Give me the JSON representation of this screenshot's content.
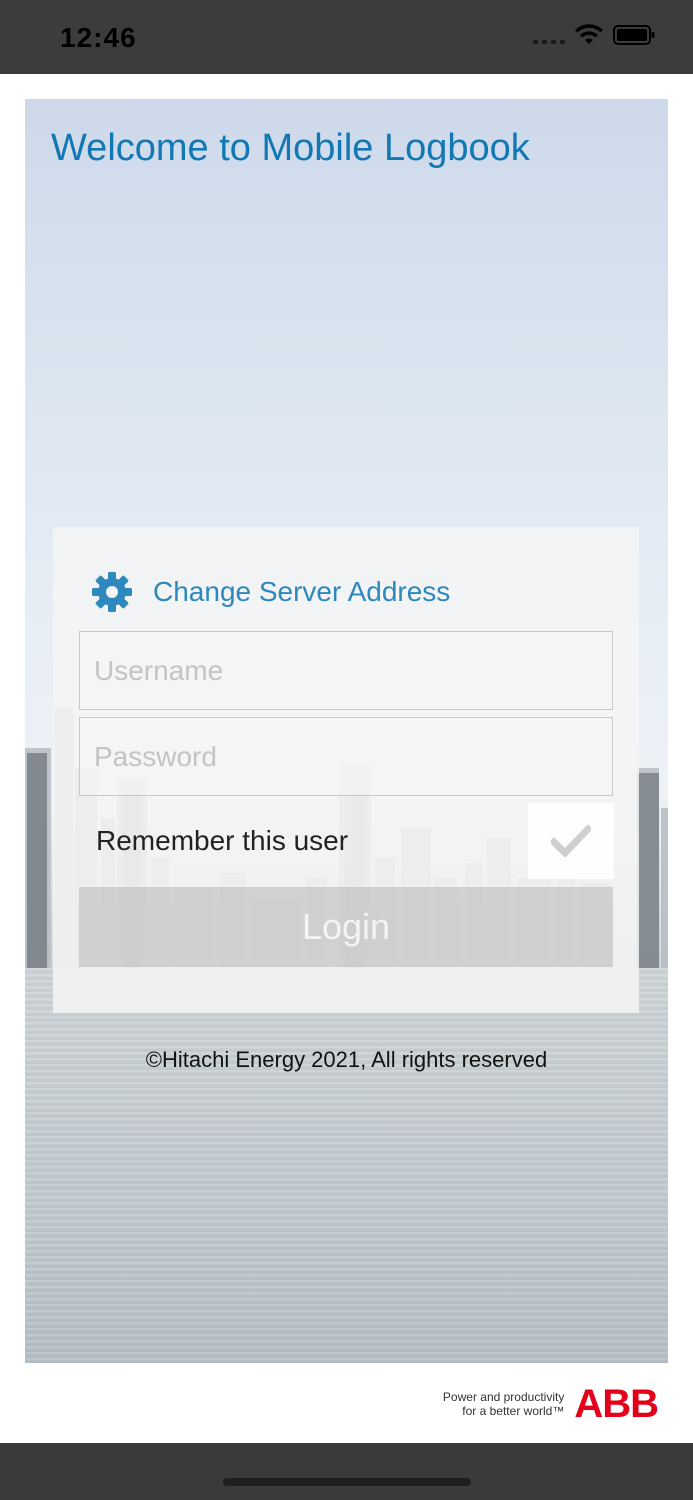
{
  "status_bar": {
    "time": "12:46"
  },
  "hero": {
    "welcome_title": "Welcome to Mobile Logbook"
  },
  "login": {
    "server_link_label": "Change Server Address",
    "username_placeholder": "Username",
    "password_placeholder": "Password",
    "remember_label": "Remember this user",
    "login_label": "Login"
  },
  "copyright": "©Hitachi Energy 2021, All rights reserved",
  "footer": {
    "tagline_line1": "Power and productivity",
    "tagline_line2": "for a better world™",
    "brand_logo_text": "ABB"
  },
  "colors": {
    "accent": "#1278b4",
    "link": "#2d88be",
    "brand_red": "#e3001b"
  }
}
